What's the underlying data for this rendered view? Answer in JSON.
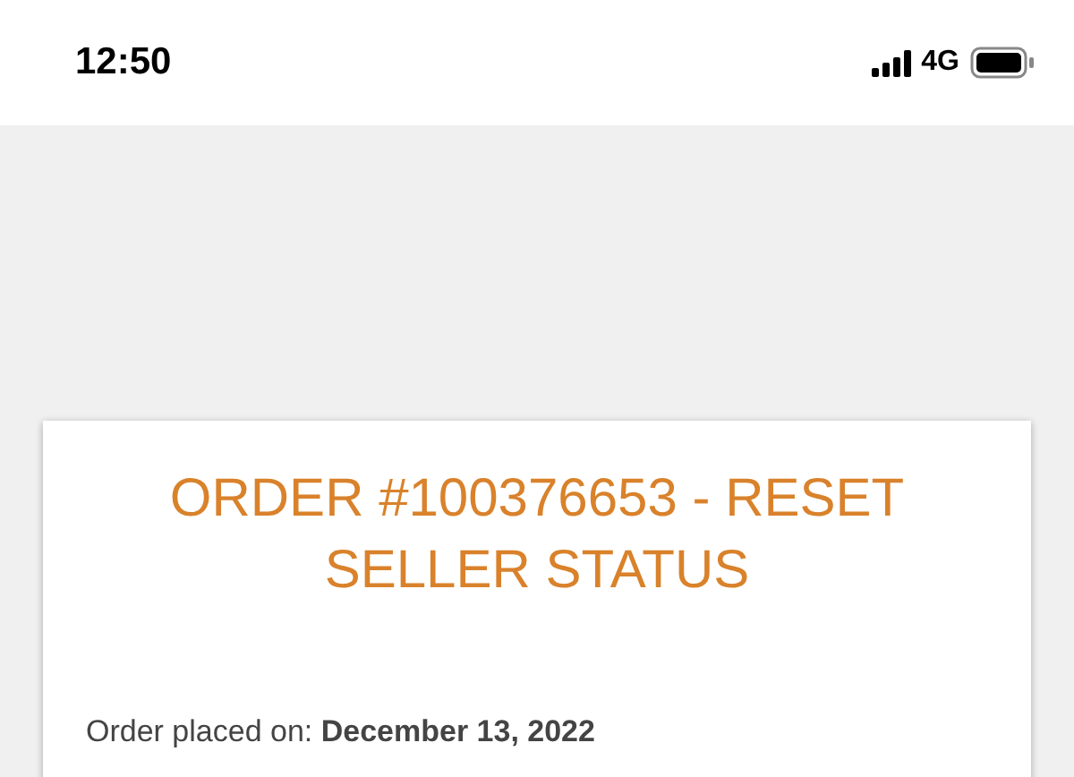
{
  "status_bar": {
    "time": "12:50",
    "network": "4G"
  },
  "order": {
    "title": "ORDER #100376653 - RESET SELLER STATUS",
    "placed": "Order placed on: **December 13, 2022**"
  }
}
